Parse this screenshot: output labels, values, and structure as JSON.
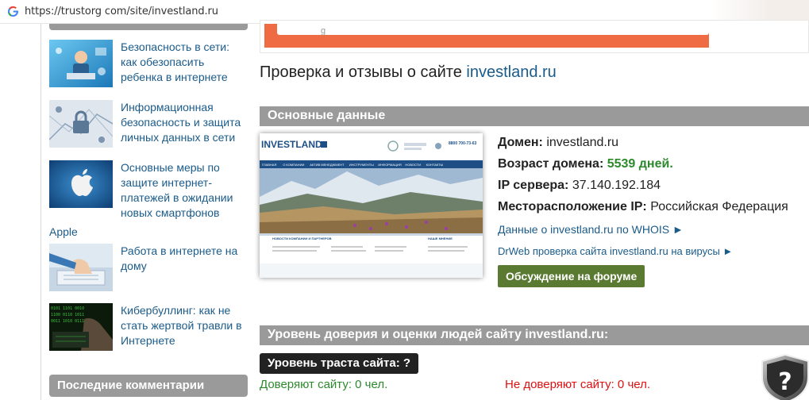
{
  "browser": {
    "url": "https://trustorg com/site/investland.ru"
  },
  "sidebar": {
    "articles": [
      {
        "title": "Безопасность в сети: как обезопасить ребенка в интернете",
        "thumb_icon": "child-laptop-thumbnail"
      },
      {
        "title": "Информационная безопасность и защита личных данных в сети",
        "thumb_icon": "padlock-network-thumbnail"
      },
      {
        "title": "Основные меры по защите интернет-платежей в ожидании новых смартфонов",
        "title_tail": "Apple",
        "thumb_icon": "apple-logo-thumbnail"
      },
      {
        "title": "Работа в интернете на дому",
        "thumb_icon": "hands-keyboard-thumbnail"
      },
      {
        "title": "Кибербуллинг: как не стать жертвой травли в Интернете",
        "thumb_icon": "code-keyboard-thumbnail"
      }
    ],
    "comments_heading": "Последние комментарии"
  },
  "main": {
    "search_placeholder_char": "g",
    "title_prefix": "Проверка и отзывы о сайте ",
    "title_domain": "investland.ru",
    "basic_heading": "Основные данные",
    "screenshot": {
      "logo": "INVESTLAND",
      "logo_tag": "™",
      "phone": "8800 700-73-63",
      "nav": [
        "ГЛАВНАЯ",
        "О КОМПАНИИ",
        "АКТИВ МЕНЕДЖМЕНТ",
        "ИНСТРУМЕНТЫ",
        "ИНФОРМАЦИЯ",
        "НОВОСТИ",
        "КОНТАКТЫ"
      ],
      "news_label": "НОВОСТИ КОМПАНИИ И ПАРТНЕРОВ",
      "side_label": "НАШЕ МНЕНИЕ"
    },
    "info": {
      "domain_label": "Домен:",
      "domain_value": "investland.ru",
      "age_label": "Возраст домена:",
      "age_value": "5539 дней.",
      "ip_label": "IP сервера:",
      "ip_value": "37.140.192.184",
      "location_label": "Месторасположение IP:",
      "location_value": "Российская Федерация",
      "whois_link": "Данные о investland.ru по WHOIS ►",
      "drweb_link": "DrWeb проверка сайта investland.ru на вирусы ►",
      "forum_button": "Обсуждение на форуме"
    },
    "trust_heading": "Уровень доверия и оценки людей сайту investland.ru:",
    "trust_badge": "Уровень траста сайта: ?",
    "trust_yes": "Доверяют сайту: 0 чел.",
    "trust_no": "Не доверяют сайту: 0 чел.",
    "shield_glyph": "?"
  },
  "colors": {
    "link": "#1a5b8a",
    "section_bar": "#9a9a9a",
    "search_accent": "#ef6b43",
    "forum_button": "#5a7a32",
    "positive": "#2c8a2c",
    "negative": "#dd1111"
  }
}
